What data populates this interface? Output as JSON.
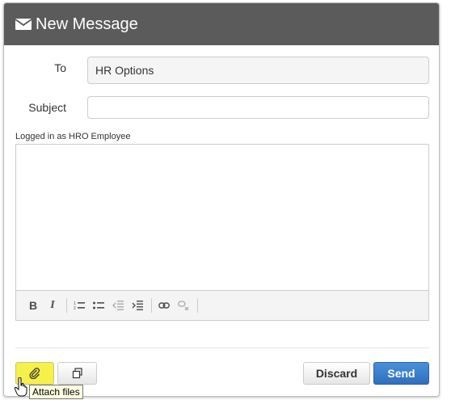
{
  "header": {
    "title": "New Message",
    "icon": "envelope-icon"
  },
  "to": {
    "label": "To",
    "value": "HR Options"
  },
  "subject": {
    "label": "Subject",
    "value": "",
    "placeholder": ""
  },
  "session_note": "Logged in as HRO Employee",
  "toolbar": {
    "items": [
      {
        "name": "bold",
        "glyph": "B"
      },
      {
        "name": "italic",
        "glyph": "I"
      },
      {
        "name": "numbered-list",
        "glyph": "1≡"
      },
      {
        "name": "bulleted-list",
        "glyph": "•≡"
      },
      {
        "name": "decrease-indent",
        "glyph": "⇤"
      },
      {
        "name": "increase-indent",
        "glyph": "⇥"
      },
      {
        "name": "link",
        "glyph": "🔗"
      },
      {
        "name": "unlink",
        "glyph": "⛓"
      }
    ]
  },
  "actions": {
    "attach_icon": "paperclip-icon",
    "copy_icon": "copy-icon",
    "discard_label": "Discard",
    "send_label": "Send"
  },
  "tooltip": "Attach files",
  "colors": {
    "header_bg": "#5b5b5b",
    "send_bg": "#3d80cc",
    "attach_bg": "#f6f04a"
  }
}
